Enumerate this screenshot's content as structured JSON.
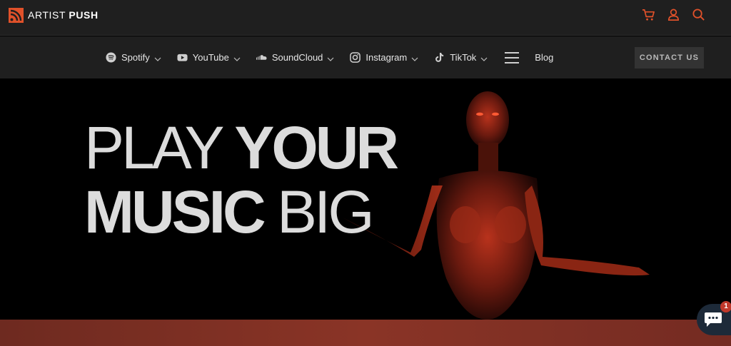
{
  "header": {
    "brand": {
      "part1": "ARTIST",
      "part2": "PUSH"
    },
    "icons": [
      "cart-icon",
      "user-icon",
      "search-icon"
    ],
    "accent": "#e0512a"
  },
  "nav": {
    "items": [
      {
        "label": "Spotify",
        "icon": "spotify-icon"
      },
      {
        "label": "YouTube",
        "icon": "youtube-icon"
      },
      {
        "label": "SoundCloud",
        "icon": "soundcloud-icon"
      },
      {
        "label": "Instagram",
        "icon": "instagram-icon"
      },
      {
        "label": "TikTok",
        "icon": "tiktok-icon"
      }
    ],
    "blog": "Blog",
    "contact": "CONTACT US"
  },
  "hero": {
    "line1_thin": "PLAY",
    "line1_bold": "YOUR",
    "line2_bold": "MUSIC",
    "line2_thin": "BIG"
  },
  "chat": {
    "badge": "1"
  },
  "colors": {
    "band": "#8a3426",
    "background": "#000000",
    "bar": "#1f1f1f"
  }
}
